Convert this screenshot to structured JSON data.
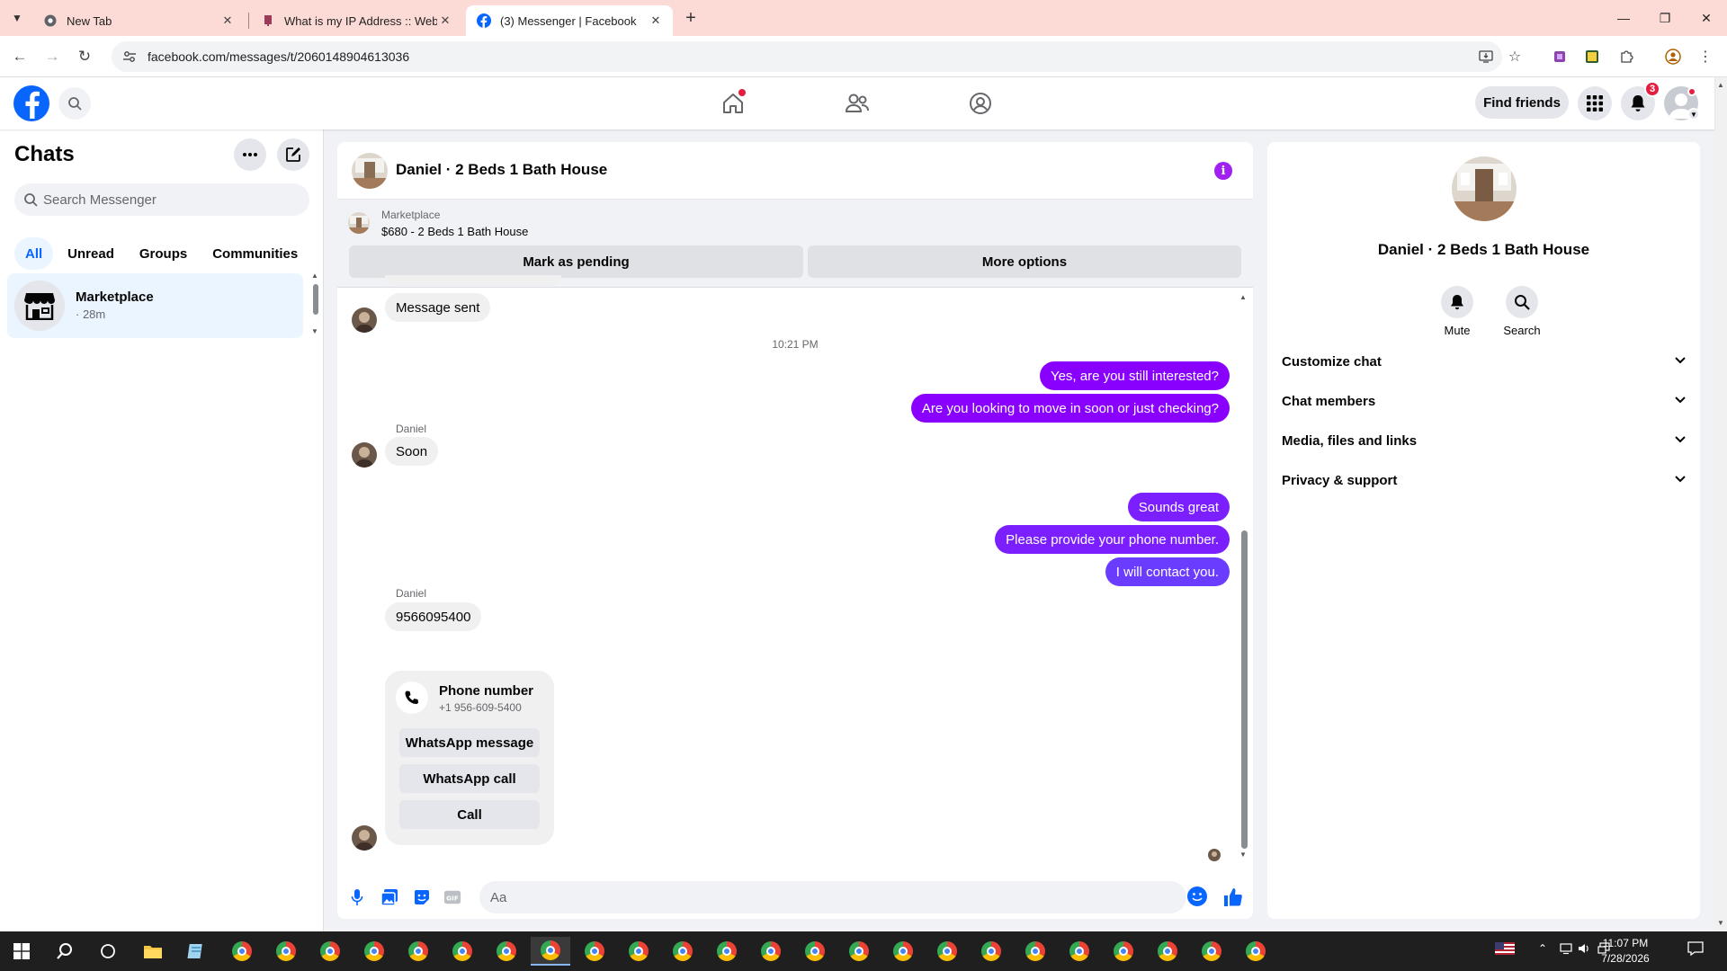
{
  "browser": {
    "tabs": [
      {
        "title": "New Tab",
        "active": false
      },
      {
        "title": "What is my IP Address :: WebBr",
        "active": false
      },
      {
        "title": "(3) Messenger | Facebook",
        "active": true
      }
    ],
    "url": "facebook.com/messages/t/2060148904613036"
  },
  "fb_header": {
    "find_friends_label": "Find friends",
    "notification_count": "3"
  },
  "chats_panel": {
    "title": "Chats",
    "search_placeholder": "Search Messenger",
    "filters": [
      "All",
      "Unread",
      "Groups",
      "Communities"
    ],
    "active_filter": "All",
    "items": [
      {
        "name": "Marketplace",
        "time": "· 28m"
      }
    ]
  },
  "conversation": {
    "title": "Daniel · 2 Beds 1 Bath House",
    "marketplace": {
      "source": "Marketplace",
      "listing": "$680 - 2 Beds 1 Bath House",
      "mark_pending_label": "Mark as pending",
      "more_options_label": "More options"
    },
    "messages": {
      "first_in": "Message sent",
      "timestamp": "10:21 PM",
      "out_1": "Yes, are you still interested?",
      "out_2": "Are you looking to move in soon or just checking?",
      "sender_1": "Daniel",
      "in_1": "Soon",
      "out_3": "Sounds great",
      "out_4": "Please provide your phone number.",
      "out_5": "I will contact you.",
      "sender_2": "Daniel",
      "in_2": "9566095400"
    },
    "phone_card": {
      "title": "Phone number",
      "number": "+1 956-609-5400",
      "whatsapp_message_label": "WhatsApp message",
      "whatsapp_call_label": "WhatsApp call",
      "call_label": "Call"
    },
    "composer_placeholder": "Aa"
  },
  "details_panel": {
    "name": "Daniel · 2 Beds 1 Bath House",
    "actions": [
      "Mute",
      "Search"
    ],
    "sections": [
      "Customize chat",
      "Chat members",
      "Media, files and links",
      "Privacy & support"
    ]
  },
  "taskbar": {
    "time": "11:07 PM",
    "date": "7/28/2026"
  },
  "colors": {
    "fb_blue": "#0866ff",
    "outgoing_bubble": "#8a00ff",
    "tabstrip": "#fcdad5",
    "badge_red": "#e41e3f"
  }
}
